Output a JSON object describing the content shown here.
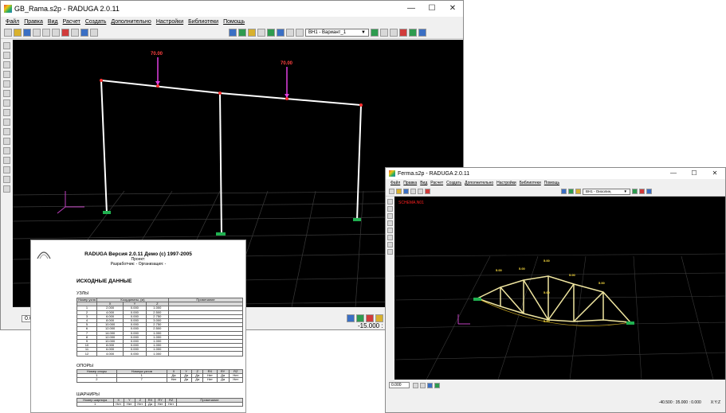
{
  "main_window": {
    "title": "GB_Rama.s2p - RADUGA 2.0.11",
    "controls": {
      "minimize": "—",
      "maximize": "☐",
      "close": "✕"
    },
    "menu": [
      "Файл",
      "Правка",
      "Вид",
      "Расчет",
      "Создать",
      "Дополнительно",
      "Настройки",
      "Библиотеки",
      "Помощь"
    ],
    "variant_select": "ВН1 - Вариант_1",
    "loads": [
      "70.00",
      "70.00"
    ],
    "status_left": "0.00",
    "status_right": "-15.000 :"
  },
  "second_window": {
    "title": "Ferma.s2p - RADUGA 2.0.11",
    "controls": {
      "minimize": "—",
      "maximize": "☐",
      "close": "✕"
    },
    "menu": [
      "Файл",
      "Правка",
      "Вид",
      "Расчет",
      "Создать",
      "Дополнительно",
      "Настройки",
      "Библиотеки",
      "Помощь"
    ],
    "variant_select": "ВН1 - Оиоолиң",
    "red_label": "SCHEMA.N01",
    "truss_labels": [
      "5.00",
      "5.00",
      "5.00",
      "5.00",
      "5.00",
      "5.00",
      "5.00"
    ],
    "status_left": "0.000",
    "status_coords": "-40.500 : 35.000 : 0.000",
    "status_plane": "X:Y:Z"
  },
  "report": {
    "header": "RADUGA Версия 2.0.11 Демо  (c) 1997-2005",
    "project": "Проект:",
    "developer": "Разработчик: -  Организация: -",
    "main_title": "ИСХОДНЫЕ ДАННЫЕ",
    "nodes_title": "УЗЛЫ",
    "nodes_headers": [
      "Номер узла",
      "X",
      "Y",
      "Z",
      "Примечание"
    ],
    "nodes_coord_caption": "Координаты, (м)",
    "nodes_rows": [
      [
        "1",
        "2.000",
        "0.000",
        "1.000"
      ],
      [
        "2",
        "4.000",
        "0.000",
        "2.500"
      ],
      [
        "3",
        "6.000",
        "0.000",
        "2.750"
      ],
      [
        "4",
        "8.000",
        "0.000",
        "3.000"
      ],
      [
        "5",
        "10.000",
        "0.000",
        "2.750"
      ],
      [
        "6",
        "12.000",
        "0.000",
        "2.500"
      ],
      [
        "7",
        "14.000",
        "0.000",
        "1.000"
      ],
      [
        "8",
        "12.000",
        "0.000",
        "1.000"
      ],
      [
        "9",
        "10.000",
        "0.000",
        "1.000"
      ],
      [
        "10",
        "8.000",
        "0.000",
        "1.000"
      ],
      [
        "11",
        "6.000",
        "0.000",
        "1.000"
      ],
      [
        "12",
        "4.000",
        "0.000",
        "1.000"
      ]
    ],
    "supports_title": "ОПОРЫ",
    "supports_headers": [
      "Номер опоры",
      "Номера узлов",
      "X",
      "Y",
      "Z",
      "RX",
      "RY",
      "RZ"
    ],
    "supports_rows": [
      [
        "1",
        "1",
        "Да",
        "Да",
        "Да",
        "Нет",
        "Да",
        "Нет"
      ],
      [
        "2",
        "7",
        "Нет",
        "Да",
        "Да",
        "Нет",
        "Да",
        "Нет"
      ]
    ],
    "hinges_title": "ШАРНИРЫ",
    "hinges_headers": [
      "Номер шарнира",
      "X",
      "Y",
      "Z",
      "RX",
      "RY",
      "RZ",
      "Примечание"
    ],
    "hinges_rows": [
      [
        "1",
        "Нет",
        "Нет",
        "Нет",
        "Да",
        "Нет",
        "Нет",
        ""
      ]
    ]
  }
}
